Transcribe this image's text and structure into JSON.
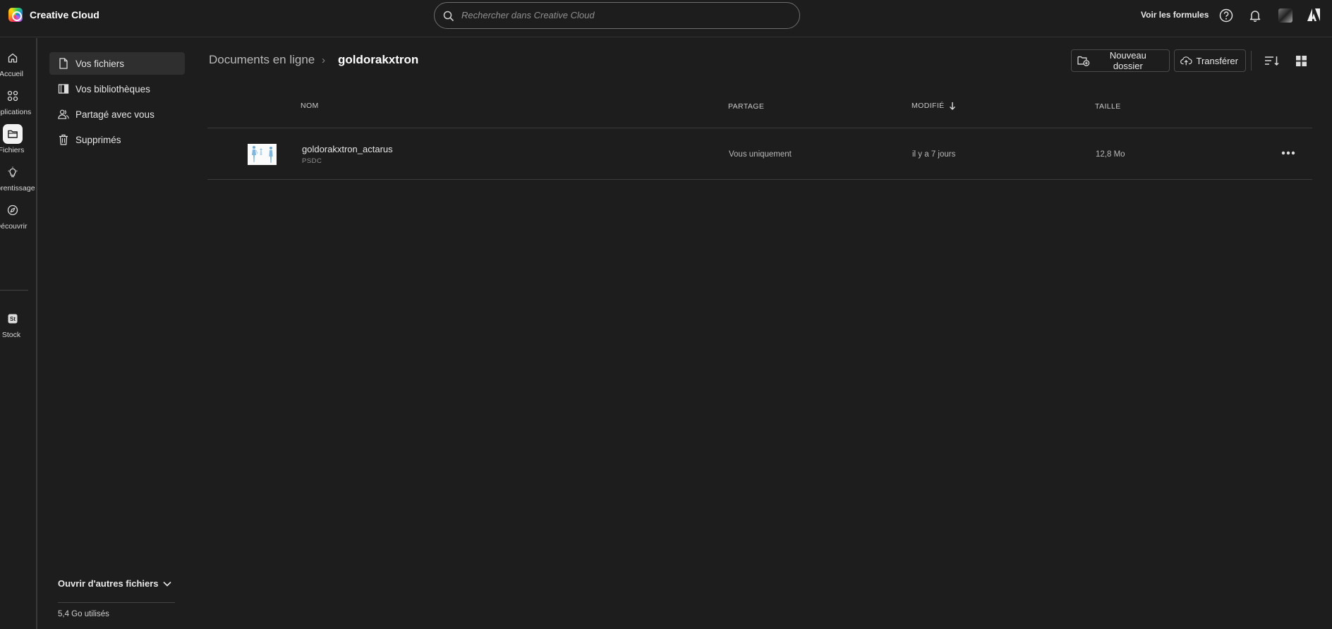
{
  "app": {
    "title": "Creative Cloud"
  },
  "search": {
    "placeholder": "Rechercher dans Creative Cloud"
  },
  "topbar": {
    "plans_label": "Voir les formules"
  },
  "rail": {
    "items": [
      {
        "label": "Accueil",
        "icon": "home-icon"
      },
      {
        "label": "Applications",
        "icon": "apps-icon"
      },
      {
        "label": "Fichiers",
        "icon": "folder-icon",
        "active": true
      },
      {
        "label": "Apprentissage",
        "icon": "lightbulb-icon"
      },
      {
        "label": "Découvrir",
        "icon": "compass-icon"
      },
      {
        "label": "Stock",
        "icon": "stock-icon"
      }
    ]
  },
  "sidenav": {
    "items": [
      {
        "label": "Vos fichiers",
        "icon": "file-icon",
        "active": true
      },
      {
        "label": "Vos bibliothèques",
        "icon": "library-icon"
      },
      {
        "label": "Partagé avec vous",
        "icon": "shared-users-icon"
      },
      {
        "label": "Supprimés",
        "icon": "trash-icon"
      }
    ],
    "other_files": "Ouvrir d'autres fichiers",
    "storage": "5,4 Go utilisés"
  },
  "breadcrumb": {
    "parent": "Documents en ligne",
    "separator": "›",
    "current": "goldorakxtron"
  },
  "toolbar": {
    "new_folder": "Nouveau dossier",
    "upload": "Transférer"
  },
  "table": {
    "headers": {
      "name": "NOM",
      "sharing": "PARTAGE",
      "modified": "MODIFIÉ",
      "size": "TAILLE"
    },
    "rows": [
      {
        "name": "goldorakxtron_actarus",
        "type": "PSDC",
        "sharing": "Vous uniquement",
        "modified": "il y a 7 jours",
        "size": "12,8 Mo"
      }
    ]
  },
  "colors": {
    "background": "#1d1d1d",
    "active_bg": "#2f2f2f",
    "border": "#3a3a3a"
  }
}
